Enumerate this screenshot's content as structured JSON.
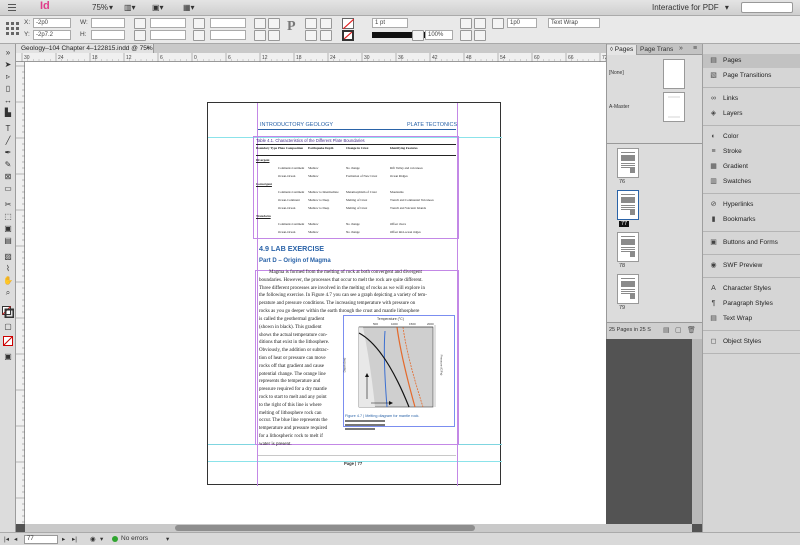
{
  "appbar": {
    "logo": "Id",
    "zoom": "75%",
    "workspace": "Interactive for PDF",
    "workspace_arrow": "▾"
  },
  "control": {
    "x_label": "X:",
    "x_value": "-2p0",
    "y_label": "Y:",
    "y_value": "-2p7.2",
    "w_label": "W:",
    "h_label": "H:",
    "stroke_weight": "1 pt",
    "opacity": "100%",
    "corner_value": "1p0",
    "text_wrap": "Text Wrap"
  },
  "doc_tab": {
    "label": "Geology–104 Chapter 4–122815.indd @ 75%",
    "close": "×"
  },
  "hruler": {
    "ticks": [
      "30",
      "24",
      "18",
      "12",
      "6",
      "0",
      "6",
      "12",
      "18",
      "24",
      "30",
      "36",
      "42",
      "48",
      "54",
      "60",
      "66",
      "72"
    ]
  },
  "document": {
    "header_left": "INTRODUCTORY GEOLOGY",
    "header_right": "PLATE TECTONICS",
    "table_title": "Table 4.1. Characteristics of the Different Plate Boundaries",
    "table_headers": [
      "Boundary Type",
      "Plate Composition",
      "Earthquake Depth",
      "Change in Crust",
      "Identifying Features"
    ],
    "table_rows": [
      [
        "Divergent",
        "",
        "",
        "",
        ""
      ],
      [
        "",
        "Continent-Continent",
        "Shallow",
        "No change",
        "Rift Valley and volcanoes"
      ],
      [
        "",
        "Ocean-Ocean",
        "Shallow",
        "Formation of New Crust",
        "Ocean Ridges"
      ],
      [
        "Convergent",
        "",
        "",
        "",
        ""
      ],
      [
        "",
        "Continent-Continent",
        "Shallow to Intermediate",
        "Metamorphism of Crust",
        "Mountains"
      ],
      [
        "",
        "Ocean-Continent",
        "Shallow to Deep",
        "Melting of Crust",
        "Trench and Continental Volcanoes"
      ],
      [
        "",
        "Ocean-Ocean",
        "Shallow to Deep",
        "Melting of Crust",
        "Trench and Volcanic Islands"
      ],
      [
        "Transform",
        "",
        "",
        "",
        ""
      ],
      [
        "",
        "Continent-Continent",
        "Shallow",
        "No change",
        "Offset rivers"
      ],
      [
        "",
        "Ocean-Ocean",
        "Shallow",
        "No change",
        "Offset mid-ocean ridges"
      ]
    ],
    "section_heading": "4.9 LAB EXERCISE",
    "part_heading": "Part D – Origin of Magma",
    "para_lines": [
      "Magma is formed from the melting of rock at both convergent and divergent",
      "boundaries. However, the processes that occur to melt the rock are quite different.",
      "Three different processes are involved in the melting of rocks as we will explore in",
      "the following exercise. In Figure 4.7 you can see a graph depicting a variety of tem-",
      "perature and pressure conditions. The increasing temperature with pressure on",
      "rocks as you go deeper within the earth through the crust and mantle lithosphere"
    ],
    "wrap_lines": [
      "is called the geothermal gradient",
      "(shown in black). This gradient",
      "shows the actual temperature con-",
      "ditions that exist in the lithosphere.",
      "Obviously, the addition or subtrac-",
      "tion of heat or pressure can move",
      "rocks off that gradient and cause",
      "potential change. The orange line",
      "represents the temperature and",
      "pressure required for a dry mantle",
      "rock to start to melt and any point",
      "to the right of this line is where",
      "melting of lithosphere rock can",
      "occur. The blue line represents the",
      "temperature and pressure required",
      "for a lithospheric rock to melt if",
      "water is present."
    ],
    "figure_top_label": "Temperature (°C)",
    "figure_ticks_x": [
      "500",
      "1000",
      "1500",
      "2000"
    ],
    "figure_left_label": "Depth (km)",
    "figure_right_label": "Pressure (GPa)",
    "figure_caption": "Figure 4.7 | Melting diagram for mantle rock.",
    "footer": "Page | 77"
  },
  "pages_panel": {
    "tab_pages": "Pages",
    "tab_trans": "Page Trans",
    "none_label": "[None]",
    "master_label": "A-Master",
    "thumb_labels": [
      "76",
      "77",
      "78",
      "79"
    ],
    "footer_text": "25 Pages in 25 S"
  },
  "sidebar": {
    "items": [
      {
        "label": "Pages",
        "icon": "pages-icon",
        "glyph": "▤"
      },
      {
        "label": "Page Transitions",
        "icon": "page-transitions-icon",
        "glyph": "▧"
      },
      {
        "label": "Links",
        "icon": "links-icon",
        "glyph": "∞"
      },
      {
        "label": "Layers",
        "icon": "layers-icon",
        "glyph": "◈"
      },
      {
        "label": "Color",
        "icon": "color-icon",
        "glyph": "◐"
      },
      {
        "label": "Stroke",
        "icon": "stroke-icon",
        "glyph": "≡"
      },
      {
        "label": "Gradient",
        "icon": "gradient-icon",
        "glyph": "▦"
      },
      {
        "label": "Swatches",
        "icon": "swatches-icon",
        "glyph": "▥"
      },
      {
        "label": "Hyperlinks",
        "icon": "hyperlinks-icon",
        "glyph": "⊘"
      },
      {
        "label": "Bookmarks",
        "icon": "bookmarks-icon",
        "glyph": "▮"
      },
      {
        "label": "Buttons and Forms",
        "icon": "buttons-forms-icon",
        "glyph": "▣"
      },
      {
        "label": "SWF Preview",
        "icon": "swf-preview-icon",
        "glyph": "◉"
      },
      {
        "label": "Character Styles",
        "icon": "character-styles-icon",
        "glyph": "A"
      },
      {
        "label": "Paragraph Styles",
        "icon": "paragraph-styles-icon",
        "glyph": "¶"
      },
      {
        "label": "Text Wrap",
        "icon": "text-wrap-icon",
        "glyph": "▤"
      },
      {
        "label": "Object Styles",
        "icon": "object-styles-icon",
        "glyph": "◻"
      }
    ]
  },
  "status": {
    "page_number": "77",
    "preflight": "No errors"
  },
  "colors": {
    "accent": "#2a63a8",
    "guide_cyan": "#8be3ea",
    "guide_purple": "#c388e6",
    "frame_blue": "#7b8ef0",
    "status_ok": "#2fa52f",
    "indesign_pink": "#e03a8a"
  }
}
